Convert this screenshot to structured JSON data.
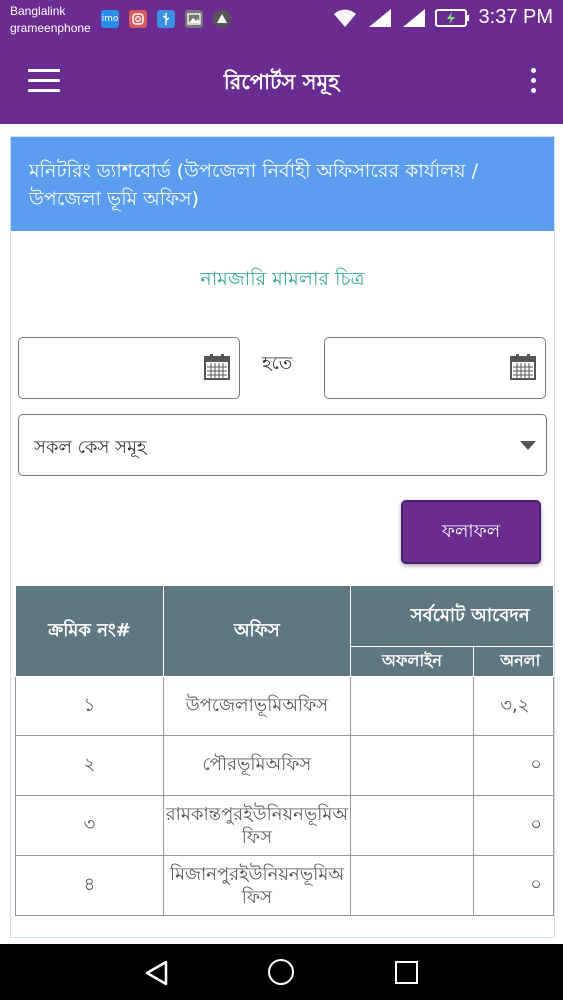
{
  "status_bar": {
    "carrier_1": "Banglalink",
    "carrier_2": "grameenphone",
    "time": "3:37 PM",
    "notification_icons": [
      "imo-icon",
      "instagram-icon",
      "usb-icon",
      "gallery-icon",
      "drive-icon"
    ],
    "status_icons": [
      "wifi-icon",
      "signal-icon",
      "signal-icon",
      "battery-charging-icon"
    ]
  },
  "app_bar": {
    "title": "রিপোর্টস সমূহ",
    "menu_icon": "hamburger-menu-icon",
    "more_icon": "more-vertical-icon"
  },
  "card": {
    "header": "মনিটরিং ড্যাশবোর্ড (উপজেলা নির্বাহী অফিসারের কার্যালয় / উপজেলা ভূমি অফিস)",
    "chart_title": "নামজারি মামলার চিত্র",
    "between_label": "হতে",
    "from_date": {
      "value": "",
      "icon": "calendar-icon"
    },
    "to_date": {
      "value": "",
      "icon": "calendar-icon"
    },
    "case_select": {
      "selected": "সকল কেস সমূহ",
      "icon": "dropdown-arrow-icon"
    },
    "result_button": "ফলাফল"
  },
  "table": {
    "headers": {
      "serial": "ক্রমিক নং#",
      "office": "অফিস",
      "total_applications": "সর্বমোট আবেদন",
      "offline": "অফলাইন",
      "online": "অনলা"
    },
    "rows": [
      {
        "serial": "১",
        "office": "উপজেলাভূমিঅফিস",
        "offline": "",
        "online": "৩,২"
      },
      {
        "serial": "২",
        "office": "পৌরভূমিঅফিস",
        "offline": "",
        "online": "০"
      },
      {
        "serial": "৩",
        "office": "রামকান্তপুরইউনিয়নভূমিঅফিস",
        "offline": "",
        "online": "০"
      },
      {
        "serial": "৪",
        "office": "মিজানপুরইউনিয়নভূমিঅফিস",
        "offline": "",
        "online": "০"
      }
    ]
  },
  "colors": {
    "primary_purple": "#6a2c91",
    "header_blue": "#5b9ef0",
    "table_header": "#5f7780",
    "teal_title": "#3aa79a"
  },
  "nav_bar": {
    "icons": [
      "back-icon",
      "home-icon",
      "recents-icon"
    ]
  }
}
